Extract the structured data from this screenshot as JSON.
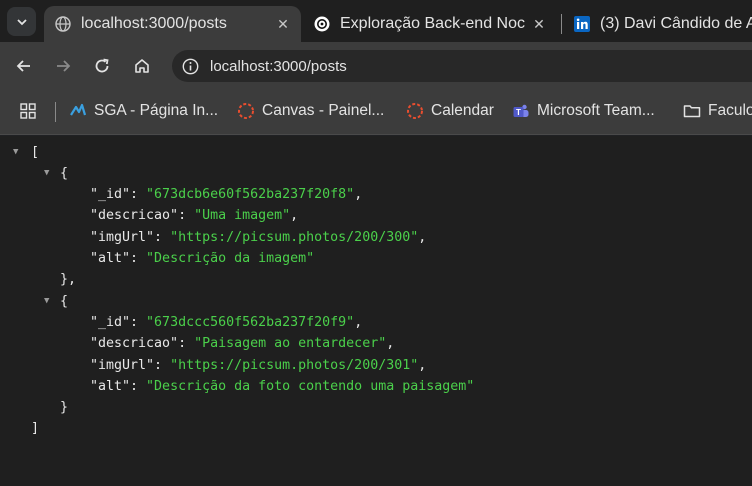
{
  "tabs": [
    {
      "title": "localhost:3000/posts",
      "favicon": "globe-icon",
      "active": true
    },
    {
      "title": "Exploração Back-end Noc",
      "favicon": "chatgpt-icon",
      "active": false
    },
    {
      "title": "(3) Davi Cândido de A",
      "favicon": "linkedin-icon",
      "active": false
    }
  ],
  "address_bar": {
    "url": "localhost:3000/posts"
  },
  "bookmarks": [
    {
      "label": "SGA - Página In..."
    },
    {
      "label": "Canvas - Painel..."
    },
    {
      "label": "Calendar"
    },
    {
      "label": "Microsoft Team..."
    },
    {
      "label": "Faculo"
    }
  ],
  "json_view": {
    "open_bracket": "[",
    "close_bracket": "]",
    "items": [
      {
        "_id": "\"673dcb6e60f562ba237f20f8\"",
        "descricao": "\"Uma imagem\"",
        "imgUrl": "\"https://picsum.photos/200/300\"",
        "alt": "\"Descrição da imagem\""
      },
      {
        "_id": "\"673dccc560f562ba237f20f9\"",
        "descricao": "\"Paisagem ao entardecer\"",
        "imgUrl": "\"https://picsum.photos/200/301\"",
        "alt": "\"Descrição da foto contendo uma paisagem\""
      }
    ],
    "keys": {
      "id": "\"_id\"",
      "descricao": "\"descricao\"",
      "imgUrl": "\"imgUrl\"",
      "alt": "\"alt\""
    }
  },
  "colors": {
    "string": "#4bd04b",
    "background": "#1f1f1f",
    "toolbar": "#3c3c3c"
  }
}
